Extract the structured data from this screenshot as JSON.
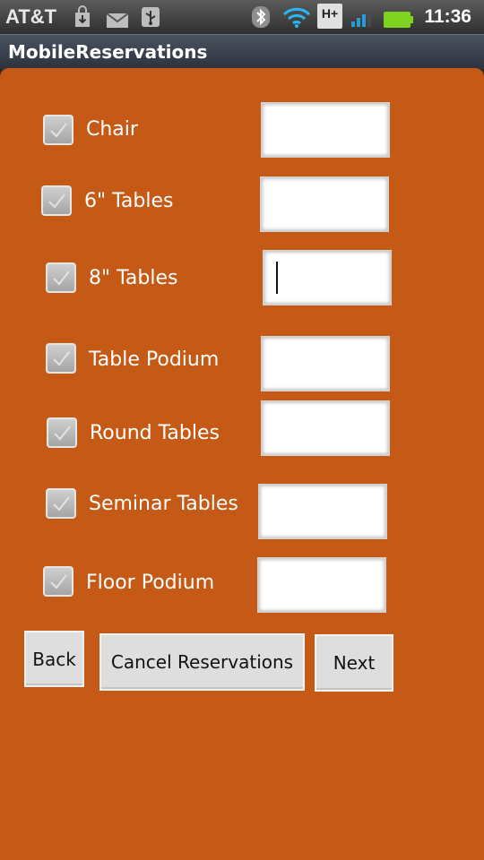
{
  "status_bar": {
    "carrier": "AT&T",
    "time": "11:36",
    "network_badge": "H+",
    "icons": [
      "download-icon",
      "mail-icon",
      "usb-icon",
      "bluetooth-icon",
      "wifi-icon",
      "signal-icon",
      "battery-icon"
    ],
    "battery_color": "#7ed321"
  },
  "title_bar": {
    "title": "MobileReservations"
  },
  "form": {
    "background": "#c55a16",
    "items": [
      {
        "label": "Chair",
        "checked": true,
        "value": ""
      },
      {
        "label": "6\" Tables",
        "checked": true,
        "value": ""
      },
      {
        "label": "8\" Tables",
        "checked": true,
        "value": "",
        "focused": true
      },
      {
        "label": "Table Podium",
        "checked": true,
        "value": ""
      },
      {
        "label": "Round Tables",
        "checked": true,
        "value": ""
      },
      {
        "label": "Seminar Tables",
        "checked": true,
        "value": ""
      },
      {
        "label": "Floor Podium",
        "checked": true,
        "value": ""
      }
    ]
  },
  "buttons": {
    "back": "Back",
    "cancel": "Cancel Reservations",
    "next": "Next"
  }
}
